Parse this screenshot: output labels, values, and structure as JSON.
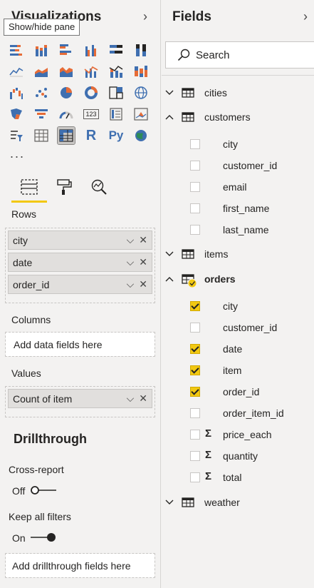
{
  "viz_pane": {
    "title": "Visualizations",
    "tooltip": "Show/hide pane",
    "more": "...",
    "icons": [
      "stacked-bar-chart-icon",
      "stacked-column-chart-icon",
      "clustered-bar-chart-icon",
      "clustered-column-chart-icon",
      "100-stacked-bar-chart-icon",
      "100-stacked-column-chart-icon",
      "line-chart-icon",
      "area-chart-icon",
      "stacked-area-chart-icon",
      "line-clustered-column-chart-icon",
      "line-stacked-column-chart-icon",
      "ribbon-chart-icon",
      "waterfall-chart-icon",
      "scatter-chart-icon",
      "pie-chart-icon",
      "donut-chart-icon",
      "treemap-icon",
      "map-icon",
      "filled-map-icon",
      "funnel-icon",
      "gauge-icon",
      "card-icon",
      "multi-row-card-icon",
      "kpi-icon",
      "slicer-icon",
      "table-icon",
      "matrix-icon",
      "r-visual-icon",
      "python-visual-icon",
      "arcgis-map-icon"
    ],
    "selected_icon": "matrix-icon",
    "r_label": "R",
    "py_label": "Py",
    "card_label": "123",
    "rows_label": "Rows",
    "rows": [
      "city",
      "date",
      "order_id"
    ],
    "columns_label": "Columns",
    "columns_placeholder": "Add data fields here",
    "values_label": "Values",
    "values": [
      "Count of item"
    ],
    "drillthrough_title": "Drillthrough",
    "cross_report_label": "Cross-report",
    "cross_report_state": "Off",
    "keep_filters_label": "Keep all filters",
    "keep_filters_state": "On",
    "drillthrough_placeholder": "Add drillthrough fields here"
  },
  "fields_pane": {
    "title": "Fields",
    "search_placeholder": "Search",
    "tables": [
      {
        "name": "cities",
        "expanded": false,
        "fields": []
      },
      {
        "name": "customers",
        "expanded": true,
        "fields": [
          {
            "name": "city",
            "checked": false,
            "measure": false
          },
          {
            "name": "customer_id",
            "checked": false,
            "measure": false
          },
          {
            "name": "email",
            "checked": false,
            "measure": false
          },
          {
            "name": "first_name",
            "checked": false,
            "measure": false
          },
          {
            "name": "last_name",
            "checked": false,
            "measure": false
          }
        ]
      },
      {
        "name": "items",
        "expanded": false,
        "fields": []
      },
      {
        "name": "orders",
        "expanded": true,
        "in_use": true,
        "fields": [
          {
            "name": "city",
            "checked": true,
            "measure": false
          },
          {
            "name": "customer_id",
            "checked": false,
            "measure": false
          },
          {
            "name": "date",
            "checked": true,
            "measure": false
          },
          {
            "name": "item",
            "checked": true,
            "measure": false
          },
          {
            "name": "order_id",
            "checked": true,
            "measure": false
          },
          {
            "name": "order_item_id",
            "checked": false,
            "measure": false
          },
          {
            "name": "price_each",
            "checked": false,
            "measure": true
          },
          {
            "name": "quantity",
            "checked": false,
            "measure": true
          },
          {
            "name": "total",
            "checked": false,
            "measure": true
          }
        ]
      },
      {
        "name": "weather",
        "expanded": false,
        "fields": []
      }
    ]
  },
  "colors": {
    "accent_yellow": "#f2c811",
    "pane_bg": "#f3f2f1",
    "viz_blue": "#3f6fb0",
    "viz_orange": "#e66c37"
  }
}
